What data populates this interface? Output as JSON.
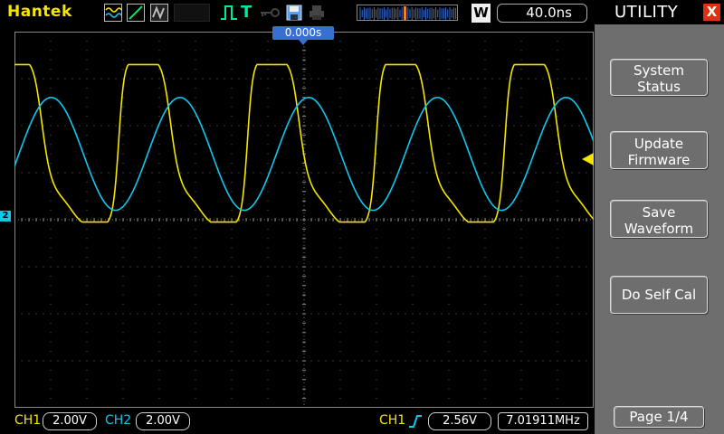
{
  "top_bar": {
    "brand": "Hantek",
    "mode_letter": "W",
    "timebase": "40.0ns",
    "trigger_time": "0.000s",
    "icons": [
      "waveform-icon",
      "line-icon",
      "gray-icon",
      "pulse-icon",
      "trigger-T-icon",
      "key-icon",
      "save-icon",
      "print-icon"
    ]
  },
  "menu": {
    "title": "UTILITY",
    "close_label": "X",
    "buttons": [
      {
        "line1": "System",
        "line2": "Status"
      },
      {
        "line1": "Update",
        "line2": "Firmware"
      },
      {
        "line1": "Save",
        "line2": "Waveform"
      },
      {
        "line1": "Do Self Cal",
        "line2": ""
      }
    ],
    "page": "Page 1/4"
  },
  "status_bar": {
    "ch1_label": "CH1",
    "ch1_scale": "2.00V",
    "ch2_label": "CH2",
    "ch2_scale": "2.00V",
    "trig_source": "CH1",
    "trig_level": "2.56V",
    "frequency": "7.01911MHz"
  },
  "markers": {
    "ch2_ground": "2"
  },
  "colors": {
    "ch1": "#f5e600",
    "ch2": "#10c8ee",
    "accent": "#3a6fd2",
    "menu_bg": "#6e6e6e",
    "close": "#e03010"
  },
  "chart_data": {
    "type": "line",
    "title": "",
    "xlabel": "",
    "ylabel": "",
    "grid": true,
    "divisions_x": 16,
    "divisions_y": 8,
    "series": [
      {
        "name": "CH1",
        "color": "#f5e600",
        "shape": "clipped-sine",
        "cycles_on_screen": 4.5,
        "min_div": -0.05,
        "max_div": 3.3
      },
      {
        "name": "CH2",
        "color": "#10c8ee",
        "shape": "sine",
        "cycles_on_screen": 4.5,
        "min_div": 0.2,
        "max_div": 2.6
      }
    ]
  }
}
